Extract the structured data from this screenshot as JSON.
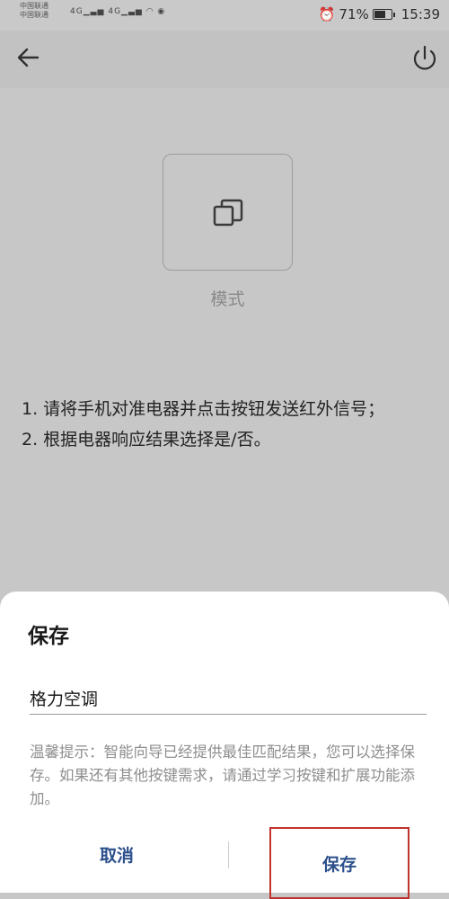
{
  "status_bar": {
    "carrier1": "中国联通",
    "carrier2": "中国联通",
    "network1": "4G",
    "network2": "4G",
    "battery_percent": "71%",
    "battery_level": 0.71,
    "time": "15:39"
  },
  "appbar": {
    "back_icon": "arrow-left-icon",
    "power_icon": "power-icon"
  },
  "mode": {
    "icon": "mode-squares-icon",
    "label": "模式"
  },
  "instructions": {
    "line1": "1. 请将手机对准电器并点击按钮发送红外信号；",
    "line2": "2. 根据电器响应结果选择是/否。"
  },
  "dialog": {
    "title": "保存",
    "input_value": "格力空调",
    "hint": "温馨提示：智能向导已经提供最佳匹配结果，您可以选择保存。如果还有其他按键需求，请通过学习按键和扩展功能添加。",
    "cancel_label": "取消",
    "save_label": "保存",
    "accent_color": "#2c4f8c",
    "highlight_color": "#c0322c"
  }
}
